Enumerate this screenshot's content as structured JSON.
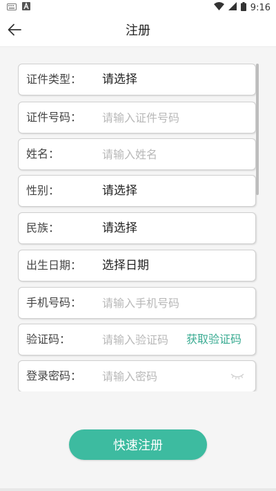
{
  "status_bar": {
    "time": "9:16",
    "icons": [
      "keyboard-icon",
      "font-a-icon",
      "wifi-icon",
      "signal-icon",
      "battery-icon"
    ]
  },
  "header": {
    "back_icon": "arrow-left-icon",
    "title": "注册"
  },
  "form": {
    "fields": [
      {
        "label": "证件类型：",
        "value": "请选择"
      },
      {
        "label": "证件号码：",
        "value": "",
        "placeholder": "请输入证件号码"
      },
      {
        "label": "姓名：",
        "value": "",
        "placeholder": "请输入姓名"
      },
      {
        "label": "性别：",
        "value": "请选择"
      },
      {
        "label": "民族：",
        "value": "请选择"
      },
      {
        "label": "出生日期：",
        "value": "选择日期"
      },
      {
        "label": "手机号码：",
        "value": "",
        "placeholder": "请输入手机号码"
      },
      {
        "label": "验证码：",
        "value": "",
        "placeholder": "请输入验证码",
        "action": "获取验证码"
      },
      {
        "label": "登录密码：",
        "value": "",
        "placeholder": "请输入密码",
        "toggle_icon": "eye-closed-icon"
      }
    ]
  },
  "submit": {
    "label": "快速注册"
  },
  "colors": {
    "accent": "#3dbba0",
    "link": "#3aab92",
    "background": "#f5f5f5",
    "placeholder": "#b8b8b8"
  }
}
